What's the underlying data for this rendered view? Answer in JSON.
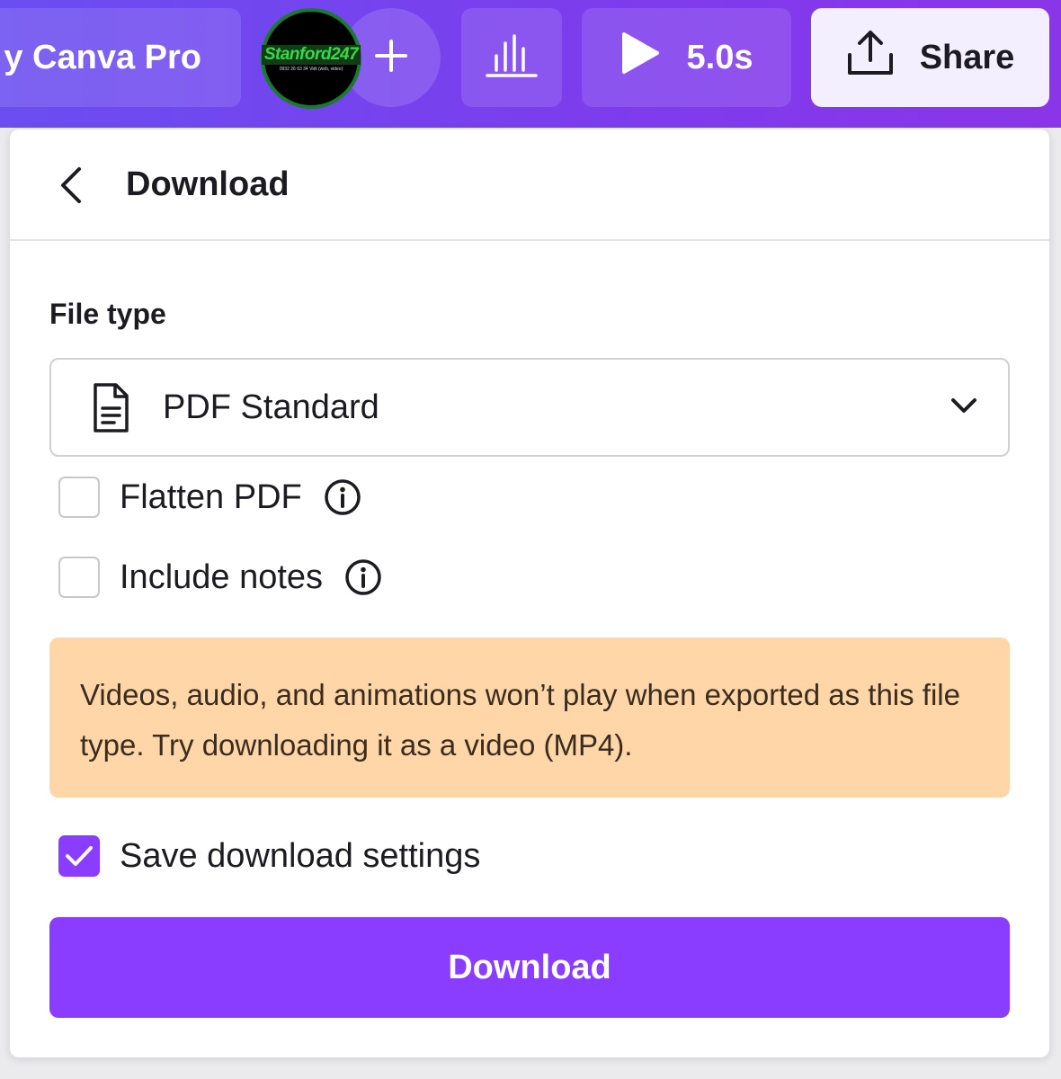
{
  "topbar": {
    "title": "y Canva Pro",
    "avatar_logo_text": "Stanford247",
    "avatar_sub_text": "0932 26 63 34 Việt (web, video)",
    "add_icon": "plus-icon",
    "chart_icon": "bar-chart-icon",
    "play_icon": "play-icon",
    "duration": "5.0s",
    "share_icon": "share-upload-icon",
    "share_label": "Share"
  },
  "panel": {
    "back_icon": "chevron-left-icon",
    "title": "Download",
    "file_type_label": "File type",
    "file_type_icon": "document-icon",
    "file_type_value": "PDF Standard",
    "dropdown_icon": "chevron-down-icon",
    "options": [
      {
        "label": "Flatten PDF",
        "checked": false,
        "info_icon": "info-icon"
      },
      {
        "label": "Include notes",
        "checked": false,
        "info_icon": "info-icon"
      }
    ],
    "warning_text": "Videos, audio, and animations won’t play when exported as this file type. Try downloading it as a video (MP4).",
    "save_settings_label": "Save download settings",
    "save_settings_checked": true,
    "download_button": "Download"
  },
  "colors": {
    "brand_purple": "#8b3dff",
    "topbar_gradient_start": "#6a4ef0",
    "topbar_gradient_end": "#8a35e8",
    "warning_bg": "#ffd6a8",
    "share_bg": "#f3efff"
  }
}
